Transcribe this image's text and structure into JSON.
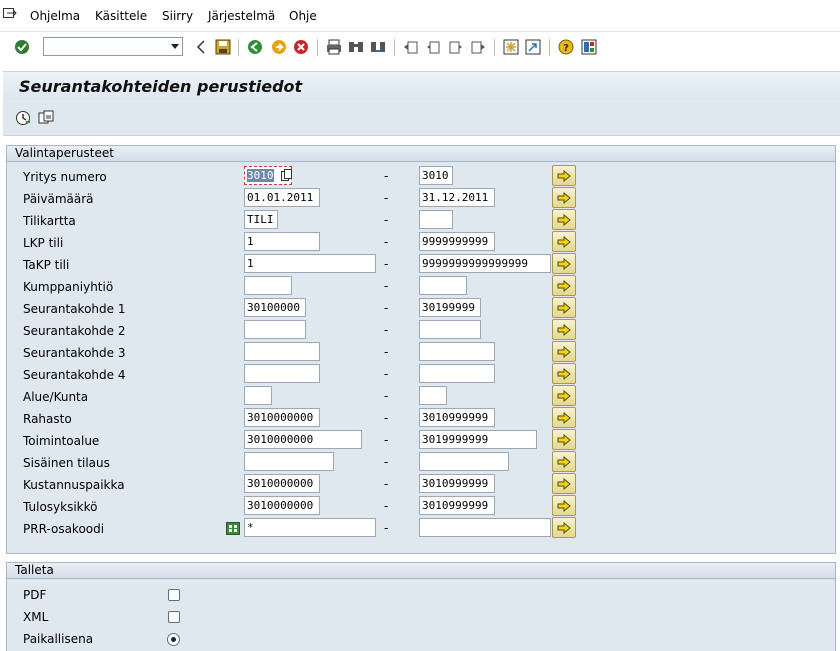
{
  "menu": [
    "Ohjelma",
    "Käsittele",
    "Siirry",
    "Järjestelmä",
    "Ohje"
  ],
  "toolbar": {
    "command_field_value": "",
    "icons": [
      "enter-icon",
      "back-icon",
      "save-icon",
      "back-green-icon",
      "exit-icon",
      "cancel-icon",
      "print-icon",
      "find-icon",
      "find-next-icon",
      "first-page-icon",
      "prev-page-icon",
      "next-page-icon",
      "last-page-icon",
      "create-session-icon",
      "shortcut-icon",
      "help-icon",
      "layout-icon"
    ]
  },
  "title": "Seurantakohteiden perustiedot",
  "app_toolbar_icons": [
    "execute-icon",
    "get-variant-icon"
  ],
  "selection": {
    "header": "Valintaperusteet",
    "dash": "-",
    "rows": [
      {
        "label": "Yritys numero",
        "low": "3010",
        "high": "3010"
      },
      {
        "label": "Päivämäärä",
        "low": "01.01.2011",
        "high": "31.12.2011"
      },
      {
        "label": "Tilikartta",
        "low": "TILI",
        "high": ""
      },
      {
        "label": "LKP tili",
        "low": "1",
        "high": "9999999999"
      },
      {
        "label": "TaKP tili",
        "low": "1",
        "high": "9999999999999999"
      },
      {
        "label": "Kumppaniyhtiö",
        "low": "",
        "high": ""
      },
      {
        "label": "Seurantakohde 1",
        "low": "30100000",
        "high": "30199999"
      },
      {
        "label": "Seurantakohde 2",
        "low": "",
        "high": ""
      },
      {
        "label": "Seurantakohde 3",
        "low": "",
        "high": ""
      },
      {
        "label": "Seurantakohde 4",
        "low": "",
        "high": ""
      },
      {
        "label": "Alue/Kunta",
        "low": "",
        "high": ""
      },
      {
        "label": "Rahasto",
        "low": "3010000000",
        "high": "3010999999"
      },
      {
        "label": "Toimintoalue",
        "low": "3010000000",
        "high": "3019999999"
      },
      {
        "label": "Sisäinen tilaus",
        "low": "",
        "high": ""
      },
      {
        "label": "Kustannuspaikka",
        "low": "3010000000",
        "high": "3010999999"
      },
      {
        "label": "Tulosyksikkö",
        "low": "3010000000",
        "high": "3010999999"
      },
      {
        "label": "PRR-osakoodi",
        "low": "*",
        "high": ""
      }
    ]
  },
  "save": {
    "header": "Talleta",
    "options": [
      {
        "label": "PDF",
        "type": "checkbox",
        "checked": false
      },
      {
        "label": "XML",
        "type": "checkbox",
        "checked": false
      },
      {
        "label": "Paikallisena",
        "type": "radio",
        "checked": true
      }
    ]
  },
  "colors": {
    "accent": "#dfe7ef",
    "multisel": "#e4d88e",
    "focus": "#d23a3a"
  }
}
